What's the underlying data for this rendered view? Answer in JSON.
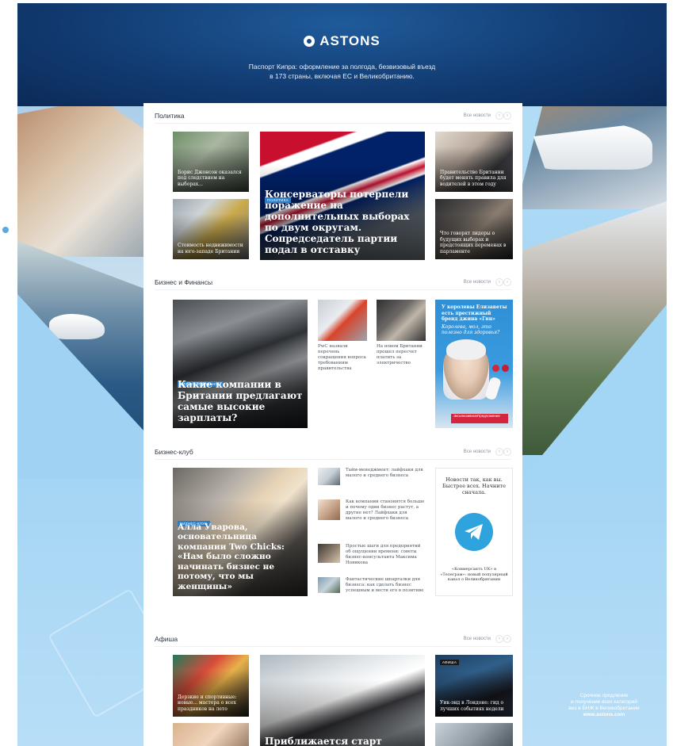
{
  "brand": {
    "logo_text": "ASTONS",
    "tagline_line1": "Паспорт Кипра: оформление за полгода, безвизовый въезд",
    "tagline_line2": "в 173 страны, включая ЕС и Великобританию."
  },
  "sections": {
    "politics": {
      "title": "Политика",
      "all_label": "Все новости",
      "main_badge": "ПОЛИТИКА",
      "main_title": "Консерваторы потерпели поражение на дополнительных выборах по двум округам. Сопредседатель партии подал в отставку",
      "left_top_title": "Борис Джонсон оказался под следствием на выборах...",
      "left_bottom_title": "Стоимость недвижимости на юго-западе Британии",
      "right_top_title": "Правительство Британии будет менять правила для водителей в этом году",
      "right_bottom_title": "Что говорят лидеры о будущих выборах и предстоящих переменах в парламенте"
    },
    "business": {
      "title": "Бизнес и Финансы",
      "all_label": "Все новости",
      "main_badge": "БИЗНЕС И ФИНАНСЫ",
      "main_title": "Какие компании в Британии предлагают самые высокие зарплаты?",
      "item1_text": "PwC назвали перечень сокращения вопроса требованиям правительства",
      "item2_text": "На новом Британии прошел пересчет платить за электричество",
      "ad_title": "У королевы Елизаветы есть престижный бренд джина «Гин»",
      "ad_sub": "Королева, мол, это полезно для здоровья?",
      "ad_button": "ЭксклюзивноеПредложение"
    },
    "club": {
      "title": "Бизнес-клуб",
      "all_label": "Все новости",
      "main_badge": "БИЗНЕС-КЛУБ",
      "main_title": "Алла Уварова, основательница компании Two Chicks: «Нам было сложно начинать бизнес не потому, что мы женщины»",
      "item1_text": "Тайм-менеджмент: лайфхаки для малого и среднего бизнеса",
      "item2_text": "Как компании становятся больше и почему одни бизнес растут, а другие нет? Лайфхаки для малого и среднего бизнеса",
      "item3_text": "Простые шаги для предприятий об ощущении времени: советы бизнес-консультанта Максима Новикова",
      "item4_text": "Фантастические шпаргалки для бизнеса: как сделать бизнес успешным и вести его в позитиве",
      "tg_text": "Новости так, как вы. Быстрее всех. Начните сначала.",
      "tg_bottom": "«Коммерсантъ UK» в «Телеграм»: новый популярный канал о Великобритании"
    },
    "afisha": {
      "title": "Афиша",
      "all_label": "Все новости",
      "left_title": "Дерзкие и спортивные: новые... мастера о всех праздников на лето",
      "main_title": "Приближается старт Королевской регаты Хенли",
      "right_badge": "АФИША",
      "right_title": "Уик-энд в Лондоне: гид о лучших событиях недели"
    }
  },
  "side_note": {
    "line1": "Срочное продление",
    "line2": "и получение всех категорий",
    "line3": "виз в БНЖ в Великобритании",
    "url": "www.astons.com"
  },
  "colors": {
    "badge_blue": "#2a7fc9",
    "telegram_blue": "#2fa3de",
    "ad_red": "#d5253c"
  }
}
